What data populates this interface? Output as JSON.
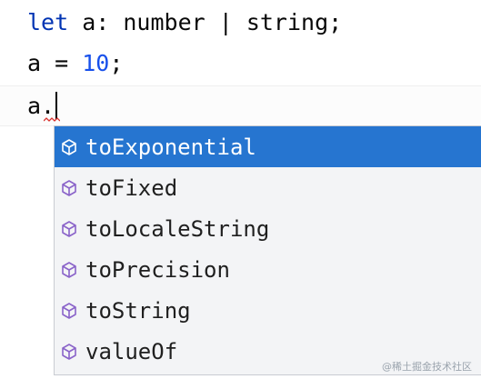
{
  "code": {
    "line1": {
      "keyword": "let",
      "rest": " a: number | string;"
    },
    "line2": {
      "prefix": "a = ",
      "number": "10",
      "suffix": ";"
    },
    "line3": {
      "text": "a."
    }
  },
  "completion": {
    "selected_index": 0,
    "items": [
      {
        "label": "toExponential",
        "icon": "method-cube-icon"
      },
      {
        "label": "toFixed",
        "icon": "method-cube-icon"
      },
      {
        "label": "toLocaleString",
        "icon": "method-cube-icon"
      },
      {
        "label": "toPrecision",
        "icon": "method-cube-icon"
      },
      {
        "label": "toString",
        "icon": "method-cube-icon"
      },
      {
        "label": "valueOf",
        "icon": "method-cube-icon"
      }
    ]
  },
  "watermark": "@稀土掘金技术社区",
  "colors": {
    "keyword": "#0033b3",
    "number": "#1750eb",
    "selection": "#2675d0",
    "icon_purple": "#8a63c9"
  }
}
